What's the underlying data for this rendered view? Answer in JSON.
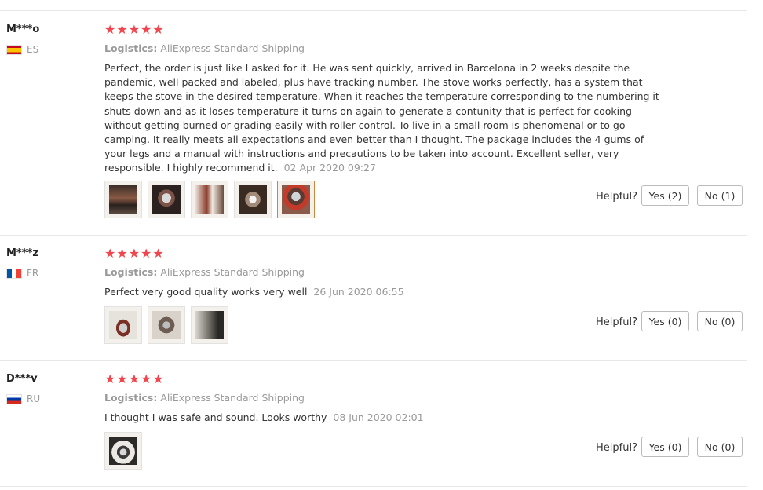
{
  "reviews": [
    {
      "user": "M***o",
      "country": "ES",
      "stars": "★★★★★",
      "logistics_label": "Logistics:",
      "logistics_value": "AliExpress Standard Shipping",
      "text": "Perfect, the order is just like I asked for it. He was sent quickly, arrived in Barcelona in 2 weeks despite the pandemic, well packed and labeled, plus have tracking number. The stove works perfectly, has a system that keeps the stove in the desired temperature. When it reaches the temperature corresponding to the numbering it shuts down and as it loses temperature it turns on again to generate a contunity that is perfect for cooking without getting burned or grading easily with roller control. To live in a small room is phenomenal or to go camping. It really meets all expectations and even better than I thought. The package includes the 4 gums of your legs and a manual with instructions and precautions to be taken into account. Excellent seller, very responsible. I highly recommend it.",
      "date": "02 Apr 2020 09:27",
      "helpful_label": "Helpful?",
      "yes_label": "Yes (2)",
      "no_label": "No (1)"
    },
    {
      "user": "M***z",
      "country": "FR",
      "stars": "★★★★★",
      "logistics_label": "Logistics:",
      "logistics_value": "AliExpress Standard Shipping",
      "text": "Perfect very good quality works very well",
      "date": "26 Jun 2020 06:55",
      "helpful_label": "Helpful?",
      "yes_label": "Yes (0)",
      "no_label": "No (0)"
    },
    {
      "user": "D***v",
      "country": "RU",
      "stars": "★★★★★",
      "logistics_label": "Logistics:",
      "logistics_value": "AliExpress Standard Shipping",
      "text": "I thought I was safe and sound. Looks worthy",
      "date": "08 Jun 2020 02:01",
      "helpful_label": "Helpful?",
      "yes_label": "Yes (0)",
      "no_label": "No (0)"
    }
  ],
  "colors": {
    "star": "#f0474f",
    "muted": "#999999",
    "separator": "#e8e8e8",
    "selected_thumb_border": "#c8883a"
  }
}
